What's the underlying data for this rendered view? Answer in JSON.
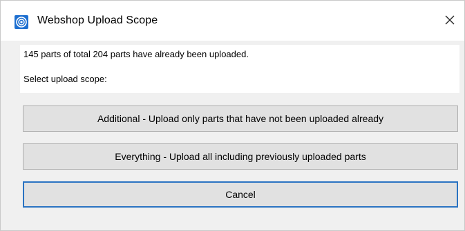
{
  "window": {
    "title": "Webshop Upload Scope",
    "icon": "app-logo-icon",
    "close_icon": "close-icon"
  },
  "info": {
    "status_text": "145 parts of total 204 parts have already been uploaded.",
    "prompt_text": "Select upload scope:"
  },
  "buttons": {
    "additional_label": "Additional - Upload only parts that have not been uploaded already",
    "everything_label": "Everything - Upload all including previously uploaded parts",
    "cancel_label": "Cancel"
  },
  "colors": {
    "accent_focus": "#2a73c2",
    "button_face": "#e1e1e1",
    "dialog_background": "#f0f0f0"
  }
}
